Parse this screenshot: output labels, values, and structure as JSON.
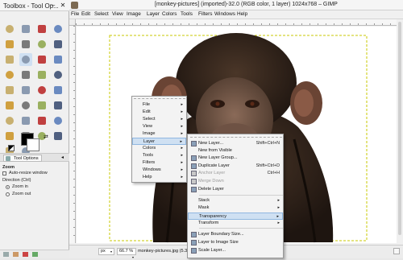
{
  "toolbox": {
    "title": "Toolbox - Tool Op...",
    "tools": [
      "rect-select-icon",
      "ellipse-select-icon",
      "free-select-icon",
      "fuzzy-select-icon",
      "select-by-color-icon",
      "scissors-icon",
      "foreground-select-icon",
      "paths-icon",
      "color-picker-icon",
      "zoom-icon",
      "measure-icon",
      "move-icon",
      "align-icon",
      "crop-icon",
      "rotate-icon",
      "scale-icon",
      "shear-icon",
      "perspective-icon",
      "flip-icon",
      "cage-icon",
      "text-icon",
      "bucket-fill-icon",
      "blend-icon",
      "pencil-icon",
      "paintbrush-icon",
      "eraser-icon",
      "airbrush-icon",
      "ink-icon",
      "clone-icon",
      "heal-icon",
      "perspective-clone-icon",
      "blur-icon",
      "smudge-icon",
      "dodge-burn-icon"
    ],
    "tool_options_tab": "Tool Options",
    "zoom_heading": "Zoom",
    "auto_resize": "Auto-resize window",
    "direction_label": "Direction  (Ctrl)",
    "zoom_in": "Zoom in",
    "zoom_out": "Zoom out"
  },
  "image_window": {
    "title": "[monkey-pictures] (imported)-32.0 (RGB color, 1 layer) 1024x768 – GIMP",
    "menubar": [
      "File",
      "Edit",
      "Select",
      "View",
      "Image",
      "Layer",
      "Colors",
      "Tools",
      "Filters",
      "Windows",
      "Help"
    ],
    "status": {
      "unit": "px",
      "zoom": "66.7 %",
      "file": "monkey-pictures.jpg (5.3 MB)"
    }
  },
  "main_menu": [
    "File",
    "Edit",
    "Select",
    "View",
    "Image",
    "Layer",
    "Colors",
    "Tools",
    "Filters",
    "Windows",
    "Help"
  ],
  "layer_menu": [
    {
      "label": "New Layer...",
      "shortcut": "Shift+Ctrl+N",
      "icon": "new-layer-icon"
    },
    {
      "label": "New from Visible",
      "shortcut": "",
      "icon": ""
    },
    {
      "label": "New Layer Group...",
      "shortcut": "",
      "icon": "new-group-icon"
    },
    {
      "label": "Duplicate Layer",
      "shortcut": "Shift+Ctrl+D",
      "icon": "duplicate-icon"
    },
    {
      "label": "Anchor Layer",
      "shortcut": "Ctrl+H",
      "icon": "anchor-icon"
    },
    {
      "label": "Merge Down",
      "shortcut": "",
      "icon": "merge-icon"
    },
    {
      "label": "Delete Layer",
      "shortcut": "",
      "icon": "delete-icon"
    },
    {
      "label": "Stack",
      "shortcut": "",
      "icon": ""
    },
    {
      "label": "Mask",
      "shortcut": "",
      "icon": ""
    },
    {
      "label": "Transparency",
      "shortcut": "",
      "icon": ""
    },
    {
      "label": "Transform",
      "shortcut": "",
      "icon": ""
    },
    {
      "label": "Layer Boundary Size...",
      "shortcut": "",
      "icon": "boundary-icon"
    },
    {
      "label": "Layer to Image Size",
      "shortcut": "",
      "icon": "to-image-icon"
    },
    {
      "label": "Scale Layer...",
      "shortcut": "",
      "icon": "scale-layer-icon"
    }
  ],
  "colors": {
    "highlight": "#cfe0f2",
    "selection_dash": "#c8c800",
    "fur": "#3a2a20"
  }
}
